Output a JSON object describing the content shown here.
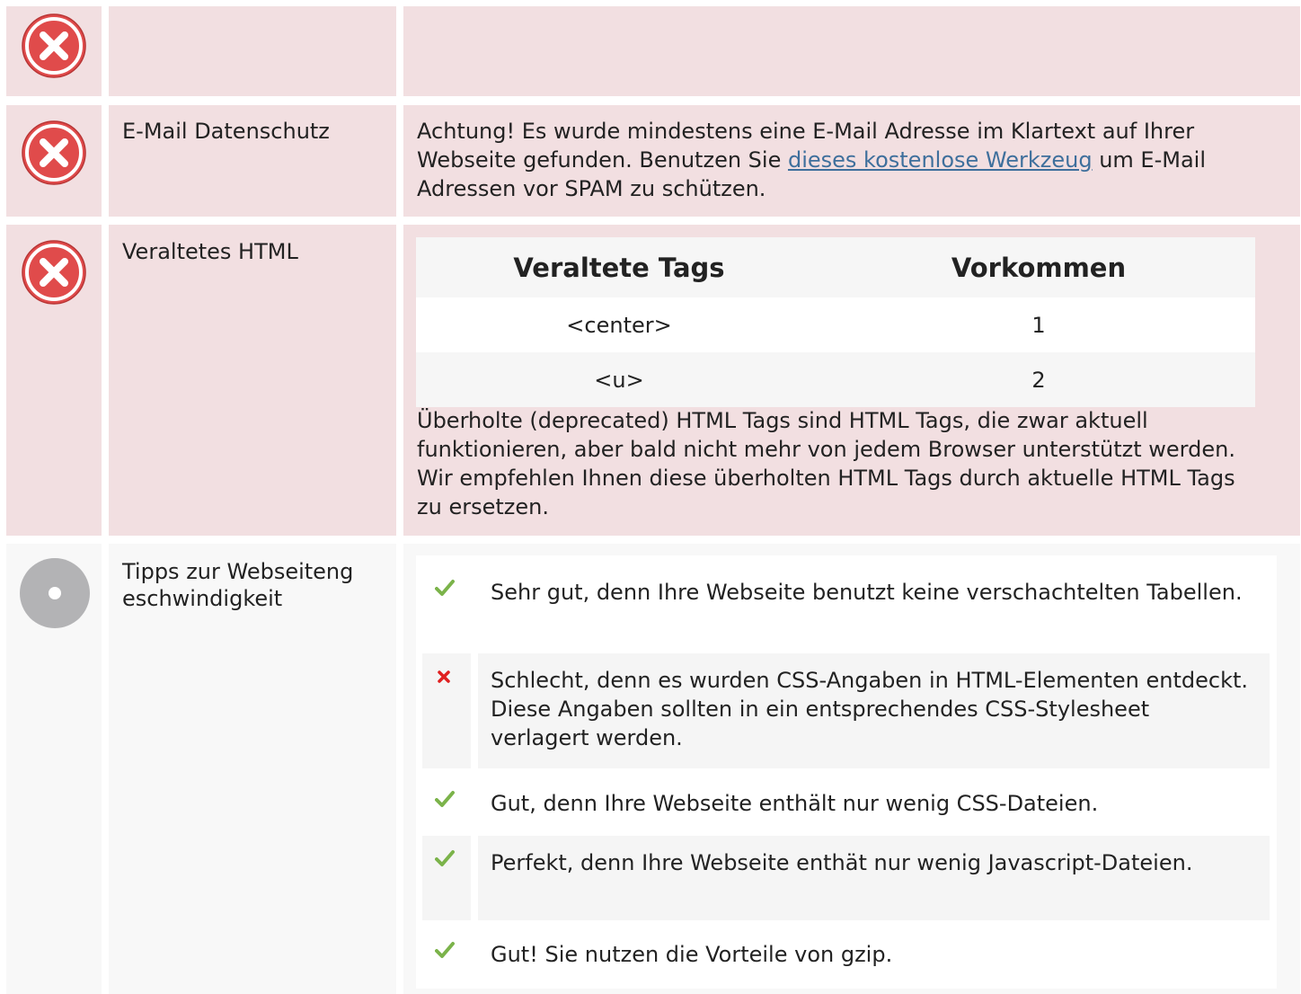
{
  "colors": {
    "error_row_bg": "#f2dfe1",
    "neutral_row_bg": "#f8f8f8",
    "error_icon": "#e04b4b",
    "neutral_icon": "#b3b3b5",
    "check": "#7bb34a",
    "cross": "#e02020",
    "link": "#3e6f9c"
  },
  "rows": [
    {
      "status_icon": "error-circle-icon",
      "label": "",
      "description": ""
    },
    {
      "status_icon": "error-circle-icon",
      "label": "E-Mail Datenschutz",
      "description_before": "Achtung! Es wurde mindestens eine E-Mail Adresse im Klartext auf Ihrer Webseite gefunden. Benutzen Sie ",
      "description_link": "dieses kostenlose Werkzeug",
      "description_after": " um E-Mail Adressen vor SPAM zu schützen."
    },
    {
      "status_icon": "error-circle-icon",
      "label": "Veraltetes HTML",
      "table": {
        "headers": [
          "Veraltete Tags",
          "Vorkommen"
        ],
        "rows": [
          [
            "<center>",
            "1"
          ],
          [
            "<u>",
            "2"
          ]
        ]
      },
      "description": "Überholte (deprecated) HTML Tags sind HTML Tags, die zwar aktuell funktionieren, aber bald nicht mehr von jedem Browser unterstützt werden. Wir empfehlen Ihnen diese überholten HTML Tags durch aktuelle HTML Tags zu ersetzen."
    },
    {
      "status_icon": "neutral-circle-icon",
      "label": "Tipps zur Webseiteng eschwindigkeit",
      "label_line1": "Tipps zur Webseiteng",
      "label_line2": "eschwindigkeit",
      "tips": [
        {
          "icon": "check-icon",
          "text": "Sehr gut, denn Ihre Webseite benutzt keine verschachtelten Tabellen."
        },
        {
          "icon": "cross-icon",
          "text": "Schlecht, denn es wurden CSS-Angaben in HTML-Elementen entdeckt. Diese Angaben sollten in ein entsprechendes CSS-Stylesheet verlagert werden."
        },
        {
          "icon": "check-icon",
          "text": "Gut, denn Ihre Webseite enthält nur wenig CSS-Dateien."
        },
        {
          "icon": "check-icon",
          "text": "Perfekt, denn Ihre Webseite enthät nur wenig Javascript-Dateien."
        },
        {
          "icon": "check-icon",
          "text": "Gut! Sie nutzen die Vorteile von gzip."
        }
      ]
    }
  ]
}
